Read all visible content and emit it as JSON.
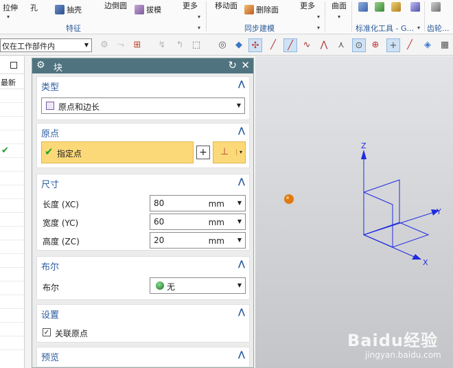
{
  "ribbon": {
    "items": [
      {
        "label": "拉伸",
        "icon": "extrude-icon"
      },
      {
        "label": "孔",
        "icon": "hole-icon"
      },
      {
        "label": "抽壳",
        "icon": "shell-icon"
      },
      {
        "label": "边倒圆",
        "icon": "edge-blend-icon"
      },
      {
        "label": "拔模",
        "icon": "draft-icon"
      },
      {
        "label": "更多",
        "icon": "more-icon"
      },
      {
        "label": "移动面",
        "icon": "move-face-icon"
      },
      {
        "label": "删除面",
        "icon": "delete-face-icon"
      },
      {
        "label": "更多",
        "icon": "more-icon"
      },
      {
        "label": "曲面",
        "icon": "surface-icon"
      }
    ],
    "groups": [
      "特征",
      "同步建模",
      "标准化工具 - G...",
      "齿轮..."
    ]
  },
  "toolbar": {
    "filter_value": "仅在工作部件内"
  },
  "left_panel": {
    "column_header": "最新"
  },
  "dialog": {
    "title": "块",
    "sections": {
      "type": {
        "title": "类型",
        "value": "原点和边长"
      },
      "origin": {
        "title": "原点",
        "specify_point": "指定点"
      },
      "dimensions": {
        "title": "尺寸",
        "fields": [
          {
            "label": "长度 (XC)",
            "value": "80",
            "unit": "mm"
          },
          {
            "label": "宽度 (YC)",
            "value": "60",
            "unit": "mm"
          },
          {
            "label": "高度 (ZC)",
            "value": "20",
            "unit": "mm"
          }
        ]
      },
      "boolean": {
        "title": "布尔",
        "label": "布尔",
        "value": "无"
      },
      "settings": {
        "title": "设置",
        "checkbox_label": "关联原点",
        "checked": true
      },
      "preview": {
        "title": "预览"
      }
    }
  },
  "viewport": {
    "axis_labels": {
      "z": "Z",
      "y": "Y",
      "x": "X"
    },
    "watermark_brand": "Baidu经验",
    "watermark_url": "jingyan.baidu.com"
  },
  "colors": {
    "dialog_title_bar": "#4f7480",
    "section_heading": "#2a5aa0",
    "specify_point_highlight": "#fcd978",
    "axis_blue": "#1f2be0",
    "point_orange": "#e07a10"
  }
}
